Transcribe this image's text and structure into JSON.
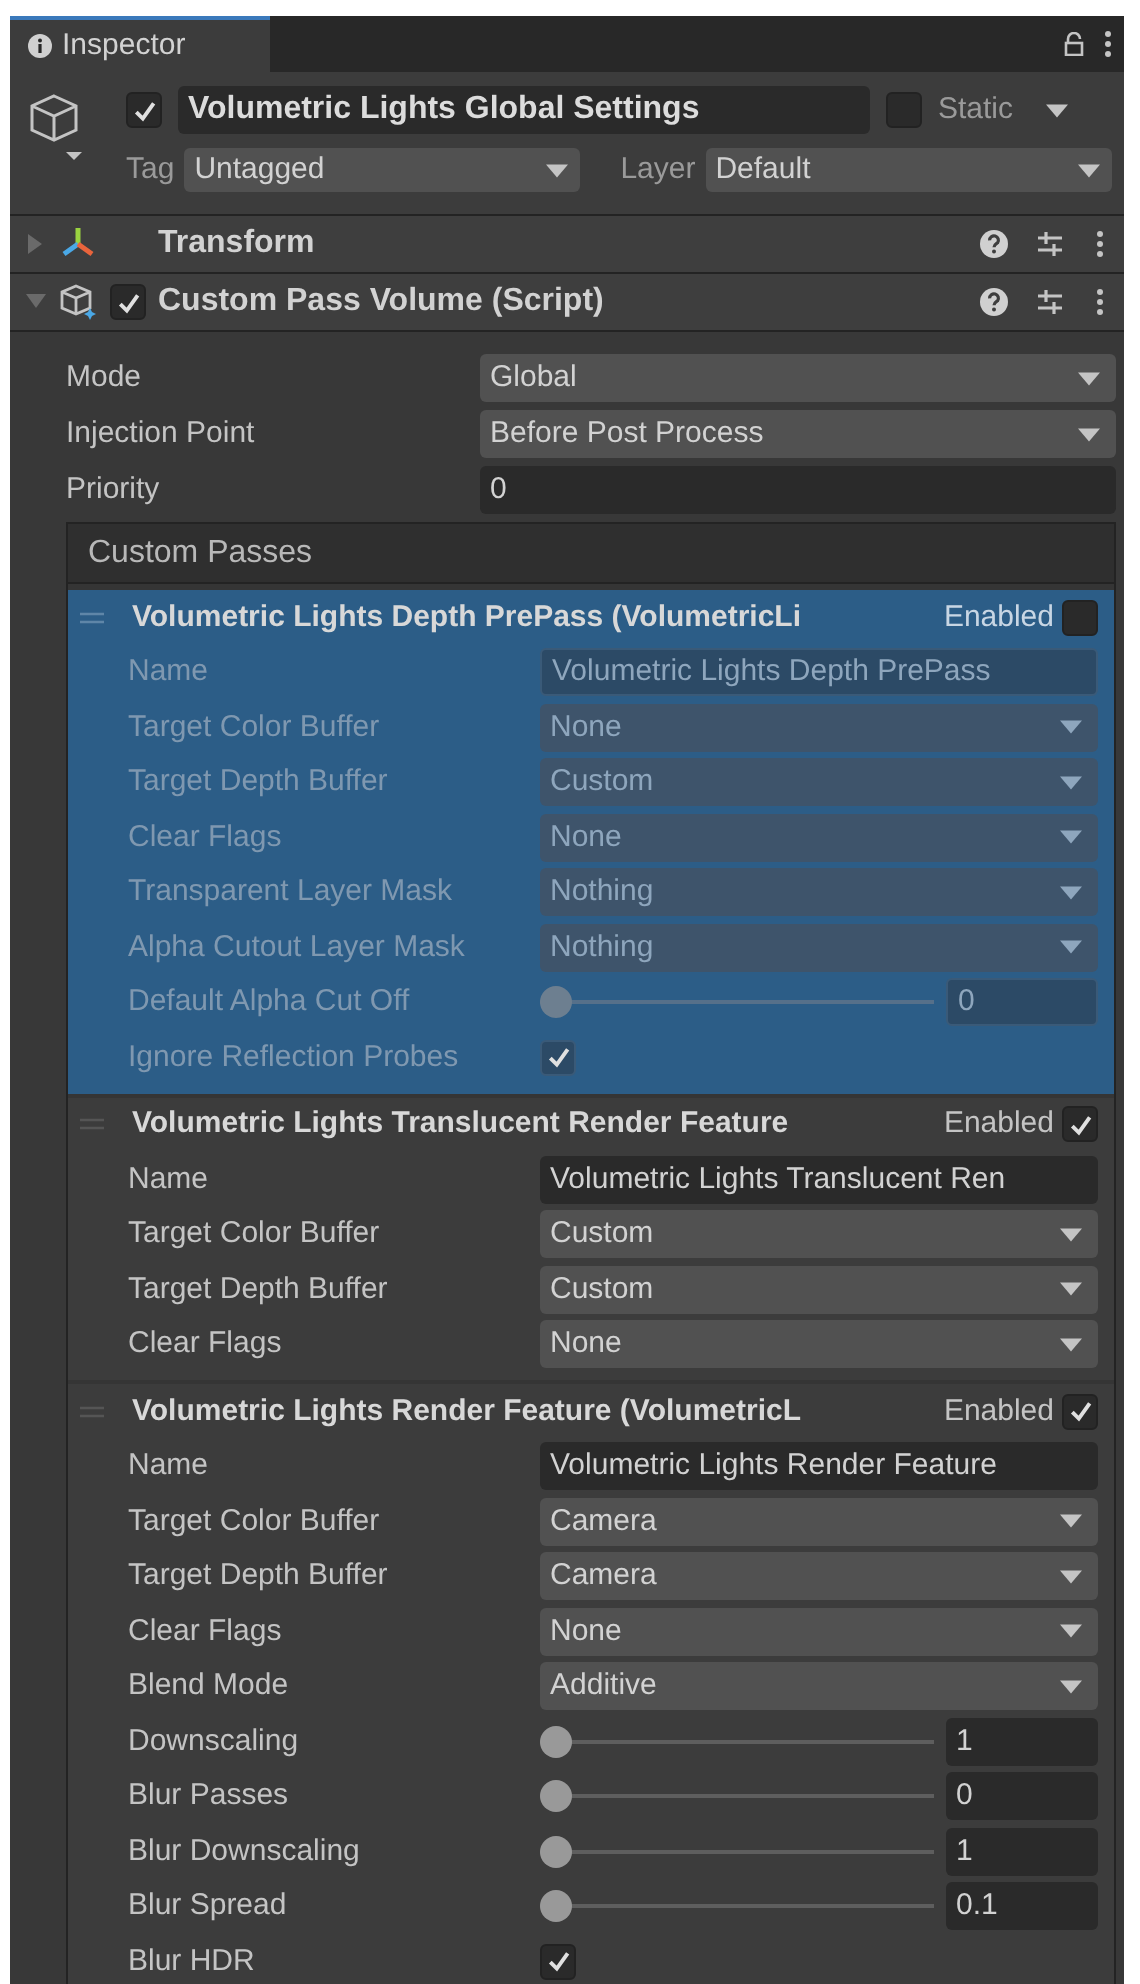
{
  "tab": {
    "label": "Inspector",
    "selected": true
  },
  "object": {
    "active": true,
    "name": "Volumetric Lights Global Settings",
    "static": false,
    "static_label": "Static",
    "tag_label": "Tag",
    "tag": "Untagged",
    "layer_label": "Layer",
    "layer": "Default"
  },
  "components": [
    {
      "name": "Transform",
      "kind": "transform",
      "expanded": false
    },
    {
      "name": "Custom Pass Volume (Script)",
      "kind": "script",
      "expanded": true,
      "enabled": true
    }
  ],
  "properties": [
    {
      "label": "Mode",
      "kind": "dropdown",
      "value": "Global"
    },
    {
      "label": "Injection Point",
      "kind": "dropdown",
      "value": "Before Post Process"
    },
    {
      "label": "Priority",
      "kind": "text",
      "value": "0"
    }
  ],
  "custom_passes": {
    "title": "Custom Passes",
    "passes": [
      {
        "title": "Volumetric Lights Depth PrePass (VolumetricLi",
        "enabled_label": "Enabled",
        "enabled": false,
        "selected": true,
        "fields": [
          {
            "label": "Name",
            "kind": "text",
            "value": "Volumetric Lights Depth PrePass"
          },
          {
            "label": "Target Color Buffer",
            "kind": "dropdown",
            "value": "None"
          },
          {
            "label": "Target Depth Buffer",
            "kind": "dropdown",
            "value": "Custom"
          },
          {
            "label": "Clear Flags",
            "kind": "dropdown",
            "value": "None"
          },
          {
            "label": "Transparent Layer Mask",
            "kind": "dropdown",
            "value": "Nothing"
          },
          {
            "label": "Alpha Cutout Layer Mask",
            "kind": "dropdown",
            "value": "Nothing"
          },
          {
            "label": "Default Alpha Cut Off",
            "kind": "slider",
            "level": 0,
            "value": "0"
          },
          {
            "label": "Ignore Reflection Probes",
            "kind": "checkbox",
            "checked": true
          }
        ]
      },
      {
        "title": "Volumetric Lights Translucent Render Feature",
        "enabled_label": "Enabled",
        "enabled": true,
        "selected": false,
        "fields": [
          {
            "label": "Name",
            "kind": "text",
            "value": "Volumetric Lights Translucent Ren"
          },
          {
            "label": "Target Color Buffer",
            "kind": "dropdown",
            "value": "Custom"
          },
          {
            "label": "Target Depth Buffer",
            "kind": "dropdown",
            "value": "Custom"
          },
          {
            "label": "Clear Flags",
            "kind": "dropdown",
            "value": "None"
          }
        ]
      },
      {
        "title": "Volumetric Lights Render Feature (VolumetricL",
        "enabled_label": "Enabled",
        "enabled": true,
        "selected": false,
        "fields": [
          {
            "label": "Name",
            "kind": "text",
            "value": "Volumetric Lights Render Feature"
          },
          {
            "label": "Target Color Buffer",
            "kind": "dropdown",
            "value": "Camera"
          },
          {
            "label": "Target Depth Buffer",
            "kind": "dropdown",
            "value": "Camera"
          },
          {
            "label": "Clear Flags",
            "kind": "dropdown",
            "value": "None"
          },
          {
            "label": "Blend Mode",
            "kind": "dropdown",
            "value": "Additive"
          },
          {
            "label": "Downscaling",
            "kind": "slider",
            "level": 0,
            "value": "1"
          },
          {
            "label": "Blur Passes",
            "kind": "slider",
            "level": 0,
            "value": "0"
          },
          {
            "label": "Blur Downscaling",
            "kind": "slider",
            "level": 0,
            "value": "1"
          },
          {
            "label": "Blur Spread",
            "kind": "slider",
            "level": 0,
            "value": "0.1"
          },
          {
            "label": "Blur HDR",
            "kind": "checkbox",
            "checked": true
          }
        ]
      }
    ]
  }
}
